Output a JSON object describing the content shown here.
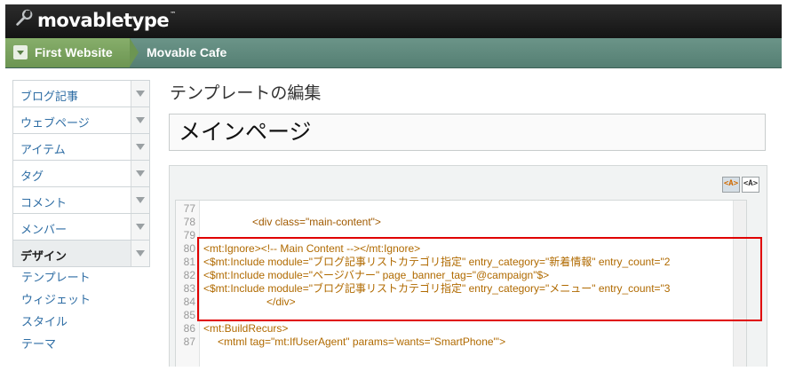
{
  "app": {
    "logo_text": "movabletype",
    "logo_tm": "™"
  },
  "nav": {
    "first_website": "First Website",
    "blog": "Movable Cafe"
  },
  "sidebar": {
    "items": [
      {
        "label": "ブログ記事"
      },
      {
        "label": "ウェブページ"
      },
      {
        "label": "アイテム"
      },
      {
        "label": "タグ"
      },
      {
        "label": "コメント"
      },
      {
        "label": "メンバー"
      },
      {
        "label": "デザイン"
      }
    ],
    "subitems": [
      {
        "label": "テンプレート"
      },
      {
        "label": "ウィジェット"
      },
      {
        "label": "スタイル"
      },
      {
        "label": "テーマ"
      }
    ]
  },
  "main": {
    "page_title": "テンプレートの編集",
    "template_name": "メインページ",
    "syntax_on": "<A>",
    "syntax_off": "<A>"
  },
  "editor": {
    "lines": [
      {
        "num": "77",
        "text": ""
      },
      {
        "num": "78",
        "text": "<div class=\"main-content\">"
      },
      {
        "num": "79",
        "text": ""
      },
      {
        "num": "80",
        "text": "<mt:Ignore><!-- Main Content --></mt:Ignore>"
      },
      {
        "num": "81",
        "text": "<$mt:Include module=\"ブログ記事リストカテゴリ指定\" entry_category=\"新着情報\" entry_count=\"2"
      },
      {
        "num": "82",
        "text": "<$mt:Include module=\"ページバナー\" page_banner_tag=\"@campaign\"$>"
      },
      {
        "num": "83",
        "text": "<$mt:Include module=\"ブログ記事リストカテゴリ指定\" entry_category=\"メニュー\" entry_count=\"3"
      },
      {
        "num": "84",
        "text": "</div>"
      },
      {
        "num": "85",
        "text": ""
      },
      {
        "num": "86",
        "text": "<mt:BuildRecurs>"
      },
      {
        "num": "87",
        "text": "<mtml tag=\"mt:IfUserAgent\" params='wants=\"SmartPhone\"'>"
      }
    ]
  },
  "colors": {
    "nav_bg": "#5f897d",
    "nav_first": "#7aa25e",
    "highlight": "#e00000",
    "link": "#2e6da4"
  }
}
